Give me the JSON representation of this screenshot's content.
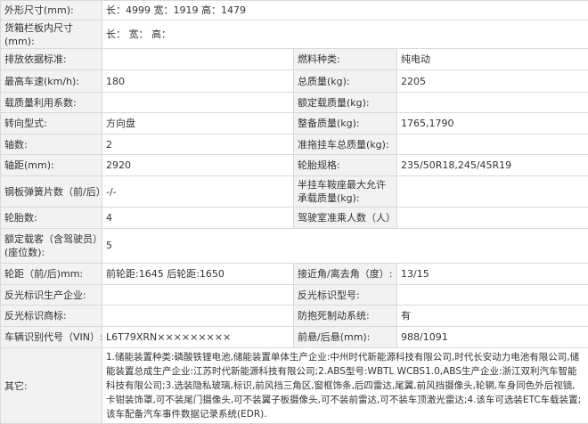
{
  "rows": {
    "dims": {
      "label": "外形尺寸(mm):",
      "value": "长：4999 宽：1919 高：1479"
    },
    "cargo": {
      "label": "货箱栏板内尺寸(mm):",
      "value": "长： 宽： 高："
    },
    "emission": {
      "label": "排放依据标准:",
      "value": "",
      "label2": "燃料种类:",
      "value2": "纯电动"
    },
    "speed": {
      "label": "最高车速(km/h):",
      "value": "180",
      "label2": "总质量(kg):",
      "value2": "2205"
    },
    "load_util": {
      "label": "载质量利用系数:",
      "value": "",
      "label2": "额定载质量(kg):",
      "value2": ""
    },
    "steering": {
      "label": "转向型式:",
      "value": "方向盘",
      "label2": "整备质量(kg):",
      "value2": "1765,1790"
    },
    "axles": {
      "label": "轴数:",
      "value": "2",
      "label2": "准拖挂车总质量(kg):",
      "value2": ""
    },
    "wheelbase": {
      "label": "轴距(mm):",
      "value": "2920",
      "label2": "轮胎规格:",
      "value2": "235/50R18,245/45R19"
    },
    "springs": {
      "label": "钢板弹簧片数（前/后）:",
      "value": "-/-",
      "label2": "半挂车鞍座最大允许承载质量(kg):",
      "value2": ""
    },
    "tires": {
      "label": "轮胎数:",
      "value": "4",
      "label2": "驾驶室准乘人数（人）:",
      "value2": ""
    },
    "seats": {
      "label": "额定载客（含驾驶员）(座位数):",
      "value": "5"
    },
    "track": {
      "label": "轮距（前/后)mm:",
      "value": "前轮距:1645 后轮距:1650",
      "label2": "接近角/离去角（度）:",
      "value2": "13/15"
    },
    "reflect_co": {
      "label": "反光标识生产企业:",
      "value": "",
      "label2": "反光标识型号:",
      "value2": ""
    },
    "reflect_mark": {
      "label": "反光标识商标:",
      "value": "",
      "label2": "防抱死制动系统:",
      "value2": "有"
    },
    "vin": {
      "label": "车辆识别代号（VIN）:",
      "value": "L6T79XRN×××××××××",
      "label2": "前悬/后悬(mm):",
      "value2": "988/1091"
    },
    "other": {
      "label": "其它:",
      "value": "1.储能装置种类:磷酸铁锂电池,储能装置单体生产企业:中州时代新能源科技有限公司,时代长安动力电池有限公司,储能装置总成生产企业:江苏时代新能源科技有限公司;2.ABS型号:WBTL WCBS1.0,ABS生产企业:浙江双利汽车智能科技有限公司;3.选装隐私玻璃,标识,前风挡三角区,窗框饰条,后四雷达,尾翼,前风挡摄像头,轮辋,车身同色外后视镜,卡钳装饰罩,可不装尾门摄像头,可不装翼子板摄像头,可不装前雷达,可不装车顶激光雷达;4.该车可选装ETC车载装置;该车配备汽车事件数据记录系统(EDR)."
    }
  }
}
